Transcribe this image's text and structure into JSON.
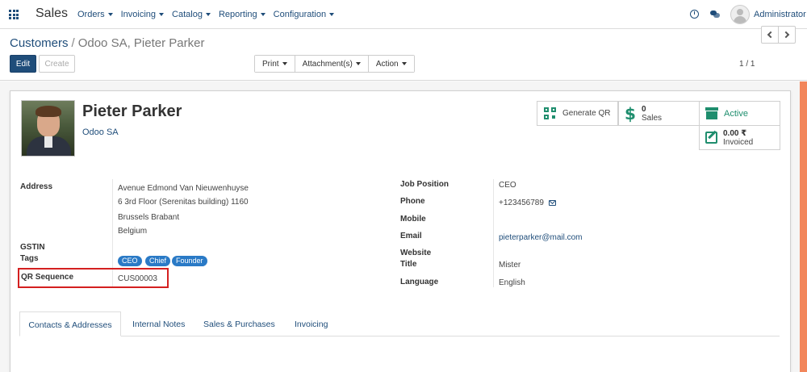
{
  "navbar": {
    "app_name": "Sales",
    "menu": [
      "Orders",
      "Invoicing",
      "Catalog",
      "Reporting",
      "Configuration"
    ],
    "user": "Administrator"
  },
  "control_panel": {
    "breadcrumb_parent": "Customers",
    "breadcrumb_separator": "/",
    "breadcrumb_current": "Odoo SA, Pieter Parker",
    "edit_label": "Edit",
    "create_label": "Create",
    "print_label": "Print",
    "attachments_label": "Attachment(s)",
    "action_label": "Action",
    "pager": "1 / 1"
  },
  "partner": {
    "name": "Pieter Parker",
    "company": "Odoo SA"
  },
  "smart_buttons": {
    "generate_qr": "Generate QR",
    "sales_count": "0",
    "sales_label": "Sales",
    "active_label": "Active",
    "invoiced_amount": "0.00 ₹",
    "invoiced_label": "Invoiced"
  },
  "left_fields": {
    "address_label": "Address",
    "address_lines": [
      "Avenue Edmond Van Nieuwenhuyse",
      "6 3rd Floor (Serenitas building) 1160",
      "Brussels  Brabant",
      "Belgium"
    ],
    "gstin_label": "GSTIN",
    "tags_label": "Tags",
    "tags": [
      "CEO",
      "Chief",
      "Founder"
    ],
    "qr_sequence_label": "QR Sequence",
    "qr_sequence_value": "CUS00003"
  },
  "right_fields": {
    "job_position_label": "Job Position",
    "job_position_value": "CEO",
    "phone_label": "Phone",
    "phone_value": "+123456789",
    "mobile_label": "Mobile",
    "email_label": "Email",
    "email_value": "pieterparker@mail.com",
    "website_label": "Website",
    "title_label": "Title",
    "title_value": "Mister",
    "language_label": "Language",
    "language_value": "English"
  },
  "tabs": [
    "Contacts & Addresses",
    "Internal Notes",
    "Sales & Purchases",
    "Invoicing"
  ],
  "colors": {
    "primary": "#1f4d7a",
    "accent_green": "#1f8e6e",
    "tag_blue": "#2a7ac6",
    "highlight_red": "#d42020",
    "scroll_strip": "#f2865b"
  }
}
